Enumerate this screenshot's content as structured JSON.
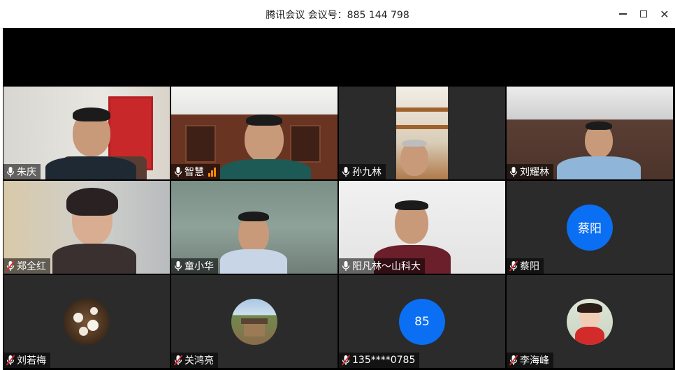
{
  "window": {
    "title": "腾讯会议 会议号：885 144 798",
    "minimize_glyph": "",
    "maximize_glyph": "",
    "close_glyph": "✕"
  },
  "participants": [
    {
      "name": "朱庆",
      "mic": "on",
      "type": "video"
    },
    {
      "name": "智慧",
      "mic": "on",
      "type": "video",
      "speaking": true
    },
    {
      "name": "孙九林",
      "mic": "on",
      "type": "video"
    },
    {
      "name": "刘耀林",
      "mic": "on",
      "type": "video"
    },
    {
      "name": "郑全红",
      "mic": "muted",
      "type": "video"
    },
    {
      "name": "童小华",
      "mic": "on",
      "type": "video"
    },
    {
      "name": "阳凡林～山科大",
      "mic": "on",
      "type": "video"
    },
    {
      "name": "蔡阳",
      "mic": "muted",
      "type": "avatar",
      "avatar_text": "蔡阳"
    },
    {
      "name": "刘若梅",
      "mic": "muted",
      "type": "photo",
      "photo": "flowers"
    },
    {
      "name": "关鸿亮",
      "mic": "muted",
      "type": "photo",
      "photo": "landscape"
    },
    {
      "name": "135****0785",
      "mic": "muted",
      "type": "avatar",
      "avatar_text": "85"
    },
    {
      "name": "李海峰",
      "mic": "muted",
      "type": "photo",
      "photo": "child"
    }
  ],
  "colors": {
    "avatar_blue": "#0a6ff2",
    "speaking_border": "#3ad36b",
    "muted_red": "#e0262b",
    "signal_orange": "#ff8a00"
  }
}
